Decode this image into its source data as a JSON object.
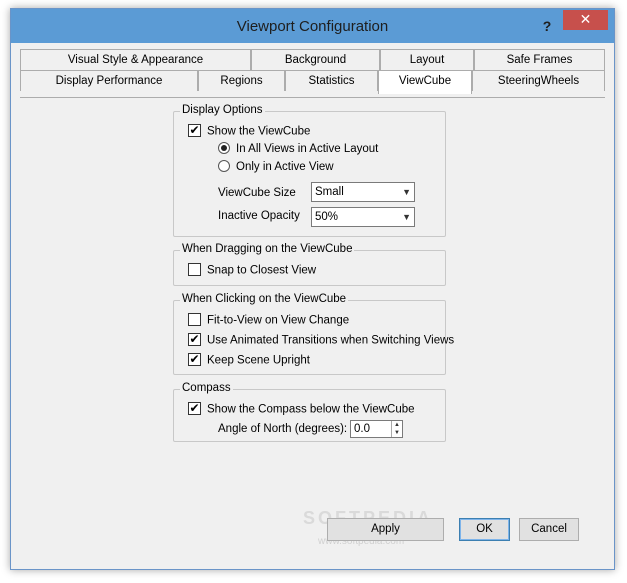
{
  "window": {
    "title": "Viewport Configuration",
    "help_glyph": "?",
    "close_glyph": "✕"
  },
  "tabs": {
    "row1": [
      "Visual Style & Appearance",
      "Background",
      "Layout",
      "Safe Frames"
    ],
    "row2": [
      "Display Performance",
      "Regions",
      "Statistics",
      "ViewCube",
      "SteeringWheels"
    ],
    "active": "ViewCube"
  },
  "display_options": {
    "title": "Display Options",
    "show_viewcube": {
      "label": "Show the ViewCube",
      "checked": true
    },
    "radio_all_views": {
      "label": "In All Views in Active Layout",
      "selected": true
    },
    "radio_active_view": {
      "label": "Only in Active View",
      "selected": false
    },
    "size_label": "ViewCube Size",
    "size_value": "Small",
    "opacity_label": "Inactive Opacity",
    "opacity_value": "50%"
  },
  "dragging": {
    "title": "When Dragging on the ViewCube",
    "snap": {
      "label": "Snap to Closest View",
      "checked": false
    }
  },
  "clicking": {
    "title": "When Clicking on the ViewCube",
    "fit_to_view": {
      "label": "Fit-to-View on View Change",
      "checked": false
    },
    "animated": {
      "label": "Use Animated Transitions when Switching Views",
      "checked": true
    },
    "upright": {
      "label": "Keep Scene Upright",
      "checked": true
    }
  },
  "compass": {
    "title": "Compass",
    "show_compass": {
      "label": "Show the Compass below the ViewCube",
      "checked": true
    },
    "angle_label": "Angle of North (degrees):",
    "angle_value": "0.0"
  },
  "buttons": {
    "apply": "Apply",
    "ok": "OK",
    "cancel": "Cancel"
  },
  "watermark": {
    "main": "SOFTPEDIA",
    "sub": "www.softpedia.com"
  },
  "icons": {
    "check": "✔",
    "dropdown": "▼",
    "spin_up": "▲",
    "spin_down": "▼"
  }
}
